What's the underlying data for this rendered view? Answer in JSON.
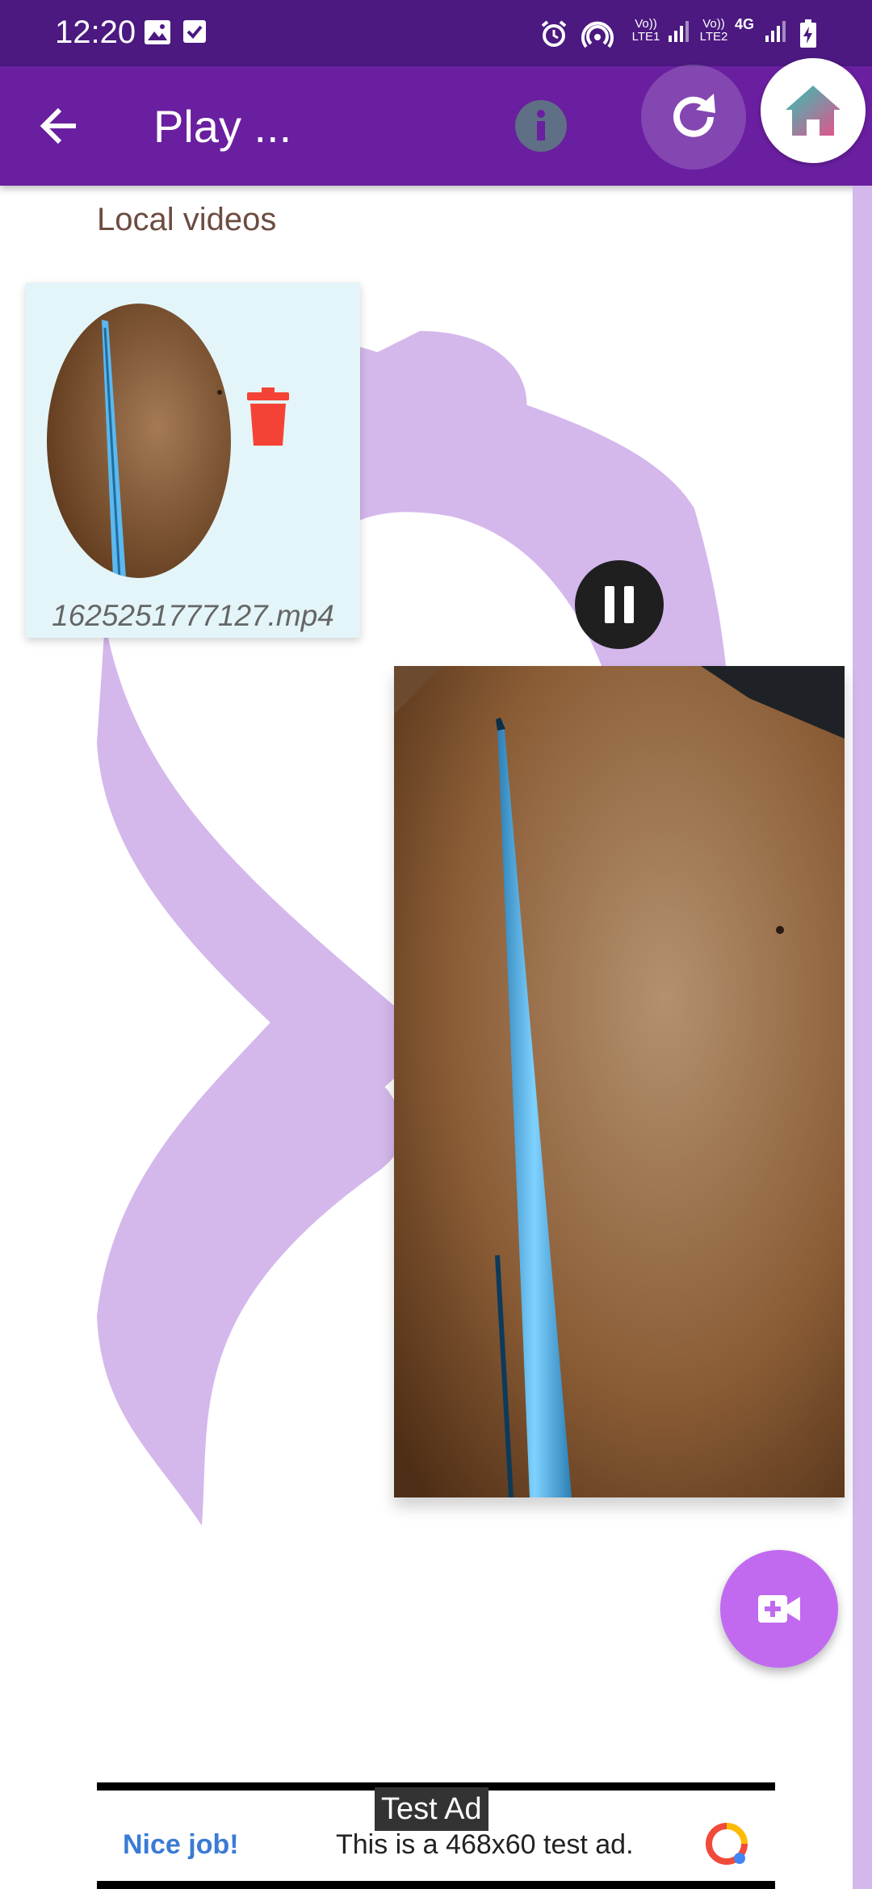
{
  "status_bar": {
    "time": "12:20",
    "left_icons": [
      "image-icon",
      "check-square-icon"
    ],
    "right_icons": [
      "alarm-icon",
      "hotspot-icon",
      "volte-lte1-icon",
      "signal-icon",
      "volte-lte2-icon",
      "4g-icon",
      "signal-icon",
      "battery-charging-icon"
    ],
    "sim1_label": "Vo)) LTE1",
    "sim2_label": "Vo)) LTE2",
    "network_label": "4G"
  },
  "app_bar": {
    "title": "Play ...",
    "actions": [
      "back-arrow-icon",
      "info-icon",
      "refresh-icon",
      "home-icon"
    ]
  },
  "section": {
    "title": "Local videos"
  },
  "videos": [
    {
      "filename": "1625251777127.mp4",
      "delete_icon": "trash-icon"
    }
  ],
  "player": {
    "state_icon": "pause-icon"
  },
  "fab": {
    "icon": "video-add-icon"
  },
  "ad": {
    "tag": "Test Ad",
    "headline": "Nice job!",
    "body": "This is a 468x60 test ad.",
    "logo": "ad-logo-icon"
  },
  "colors": {
    "status_bar": "#4b1980",
    "app_bar": "#6a1fa0",
    "ribbon": "#d4b8ec",
    "fab": "#c16af0",
    "delete": "#f44336",
    "card_bg": "#e3f5f8"
  }
}
